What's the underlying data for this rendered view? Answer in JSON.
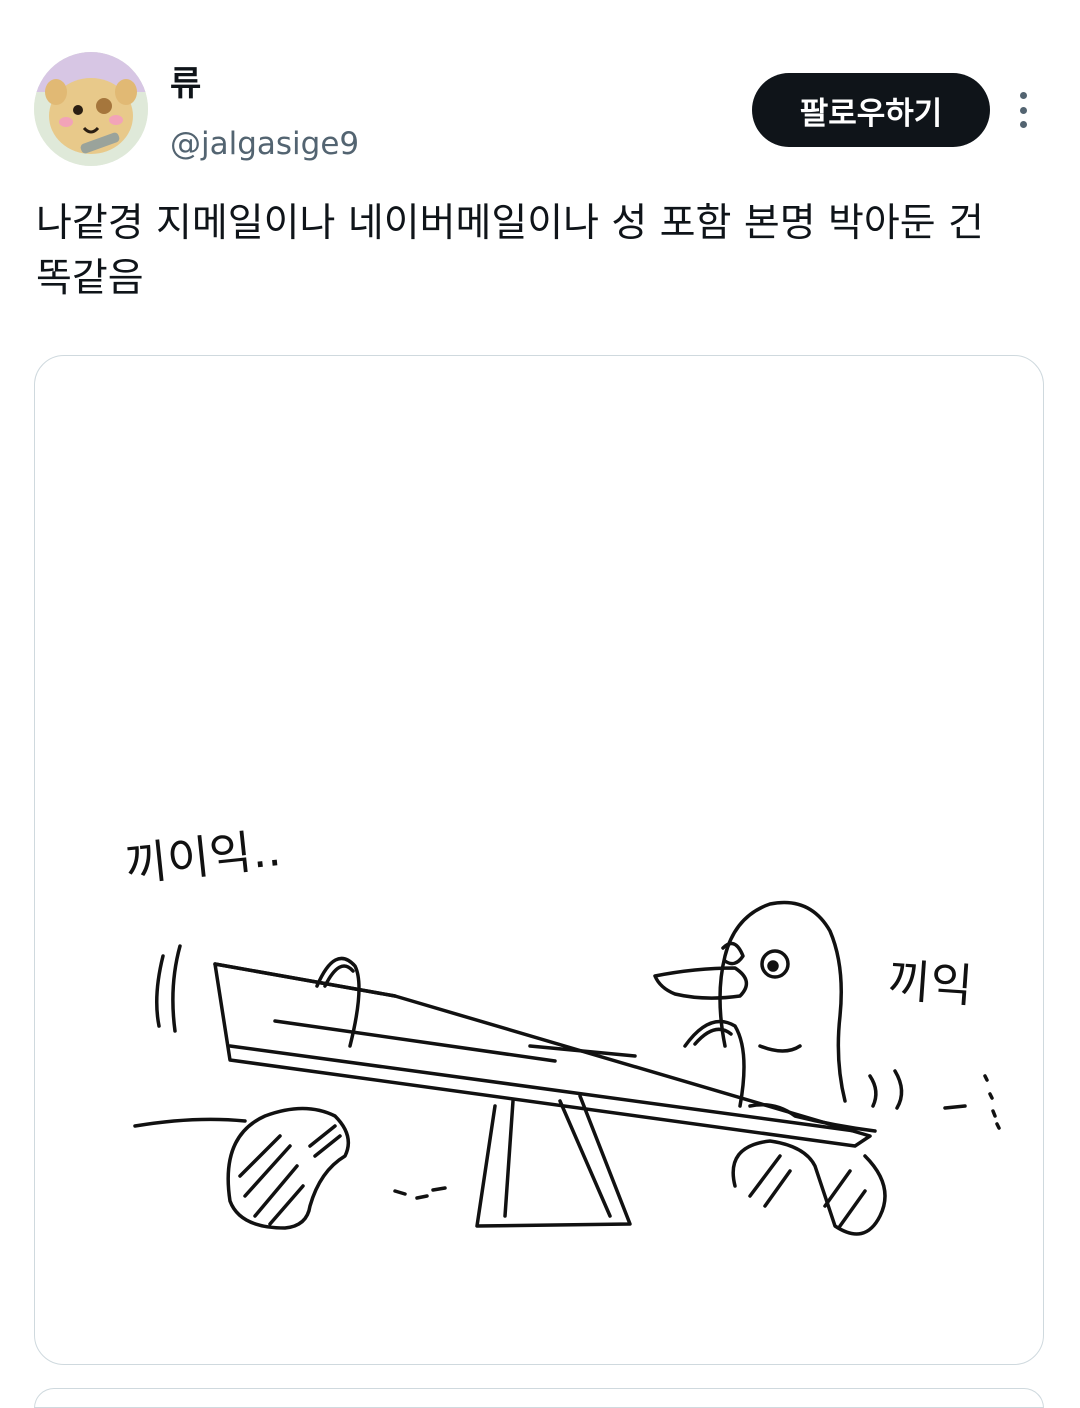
{
  "user": {
    "display_name": "류",
    "handle": "@jalgasige9"
  },
  "actions": {
    "follow_label": "팔로우하기",
    "more_icon": "more-vertical-icon"
  },
  "tweet": {
    "text": "나같경 지메일이나 네이버메일이나 성 포함 본명 박아둔 건 똑같음"
  },
  "media": {
    "sketch_text_left": "끼이익..",
    "sketch_text_right": "끼익"
  }
}
